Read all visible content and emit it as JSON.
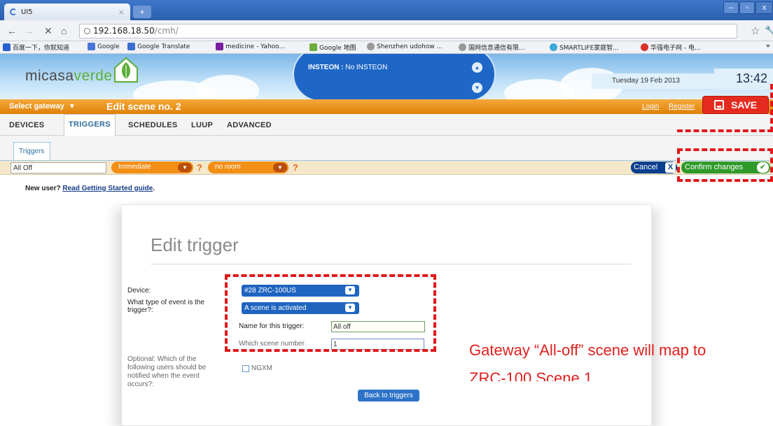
{
  "browser": {
    "tab_title": "UI5",
    "url_host": "192.168.18.50",
    "url_path": "/cmh/",
    "bookmarks": [
      "百度一下，你就知道",
      "Google",
      "Google Translate",
      "medicine - Yahoo...",
      "Google 地图",
      "Shenzhen udohow ...",
      "国网信息通信有限...",
      "SMARTLIFE家庭智...",
      "华强电子网 - 电..."
    ]
  },
  "header": {
    "logo_part1": "micasa",
    "logo_part2": "verde",
    "insteon_label": "INSTEON :",
    "insteon_value": " No INSTEON",
    "date": "Tuesday 19 Feb 2013",
    "time": "13:42",
    "select_gateway": "Select gateway",
    "scene_title": "Edit scene no. 2",
    "login": "Login",
    "register": "Register",
    "save": "SAVE"
  },
  "tabs": [
    "DEVICES",
    "TRIGGERS",
    "SCHEDULES",
    "LUUP",
    "ADVANCED"
  ],
  "subtab": "Triggers",
  "trigger_bar": {
    "name_value": "All Off",
    "mode": "Immediate",
    "room": "no room",
    "help": "?",
    "cancel": "Cancel",
    "confirm": "Confirm changes"
  },
  "new_user": {
    "prefix": "New user?",
    "link": "Read Getting Started guide",
    "suffix": "."
  },
  "edit_trigger": {
    "title": "Edit trigger",
    "device_label": "Device:",
    "device_value": "#28 ZRC-100US",
    "event_label_1": "What type of event is the",
    "event_label_2": "trigger?:",
    "event_value": "A scene is activated",
    "name_label": "Name for this trigger:",
    "name_value": "All off",
    "scene_label": "Which scene number",
    "scene_value": "1",
    "optional_lines": [
      "Optional: Which of the",
      "following users should be",
      "notified when the event",
      "occurs?:"
    ],
    "user": "NGXM",
    "back": "Back to triggers"
  },
  "annotation": {
    "line1": "Gateway “All-off” scene will map to",
    "line2": "ZRC-100 Scene 1"
  },
  "colors": {
    "orange_bar": "#e8900f",
    "save_red": "#e52a1f",
    "confirm_green": "#2f9a2a",
    "cancel_blue": "#0a3e8f",
    "dropdown_blue": "#1f65c0",
    "annotation_red": "#e0211e"
  }
}
